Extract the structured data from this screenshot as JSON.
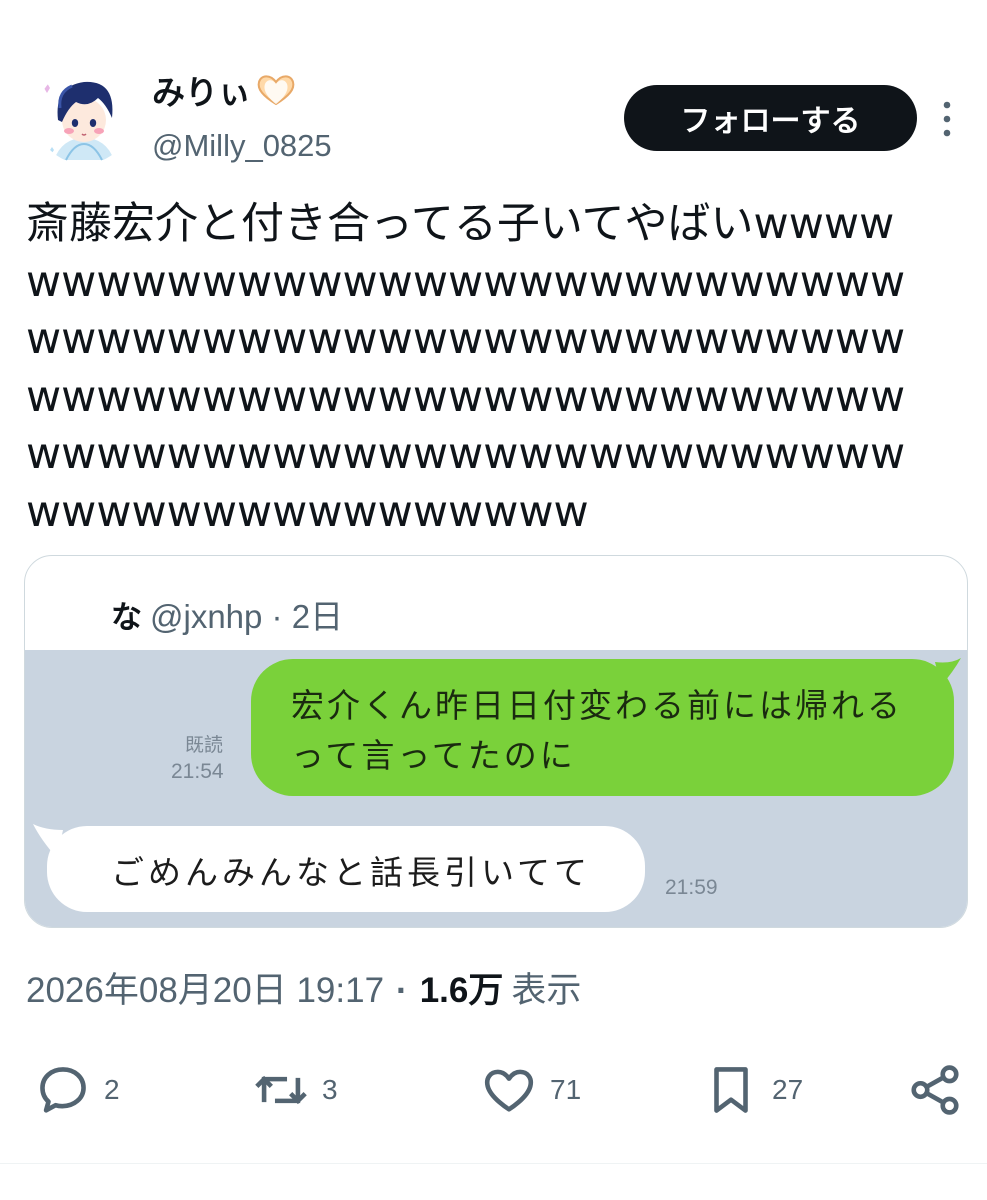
{
  "author": {
    "display_name": "みりぃ",
    "name_emoji": "heart-hands-icon",
    "handle": "@Milly_0825",
    "follow_label": "フォローする"
  },
  "tweet": {
    "text": "斎藤宏介と付き合ってる子いてやばいwwwwwwwwwwwwwwwwwwwwwwwwwwwwwwwwwwwwwwwwwwwwwwwwwwwwwwwwwwwwwwwwwwwwwwwwwwwwwwwwwwwwwwwwwwwwwwwwwwwwwwwwwwwwwwwwwwwwwwww"
  },
  "quote": {
    "name": "な",
    "meta": "@jxnhp · 2日",
    "chat": {
      "sent_message": "宏介くん昨日日付変わる前には帰れるって言ってたのに",
      "read_label": "既読",
      "sent_time": "21:54",
      "received_message": "ごめんみんなと話長引いてて",
      "received_time": "21:59"
    }
  },
  "meta": {
    "datetime": "2026年08月20日 19:17",
    "separator": "·",
    "views_count": "1.6万",
    "views_label": "表示"
  },
  "actions": {
    "reply_count": "2",
    "retweet_count": "3",
    "like_count": "71",
    "bookmark_count": "27"
  },
  "colors": {
    "follow_bg": "#0f1419",
    "secondary_text": "#536471",
    "line_green": "#7ad13a",
    "line_bg": "#c9d4e0"
  }
}
